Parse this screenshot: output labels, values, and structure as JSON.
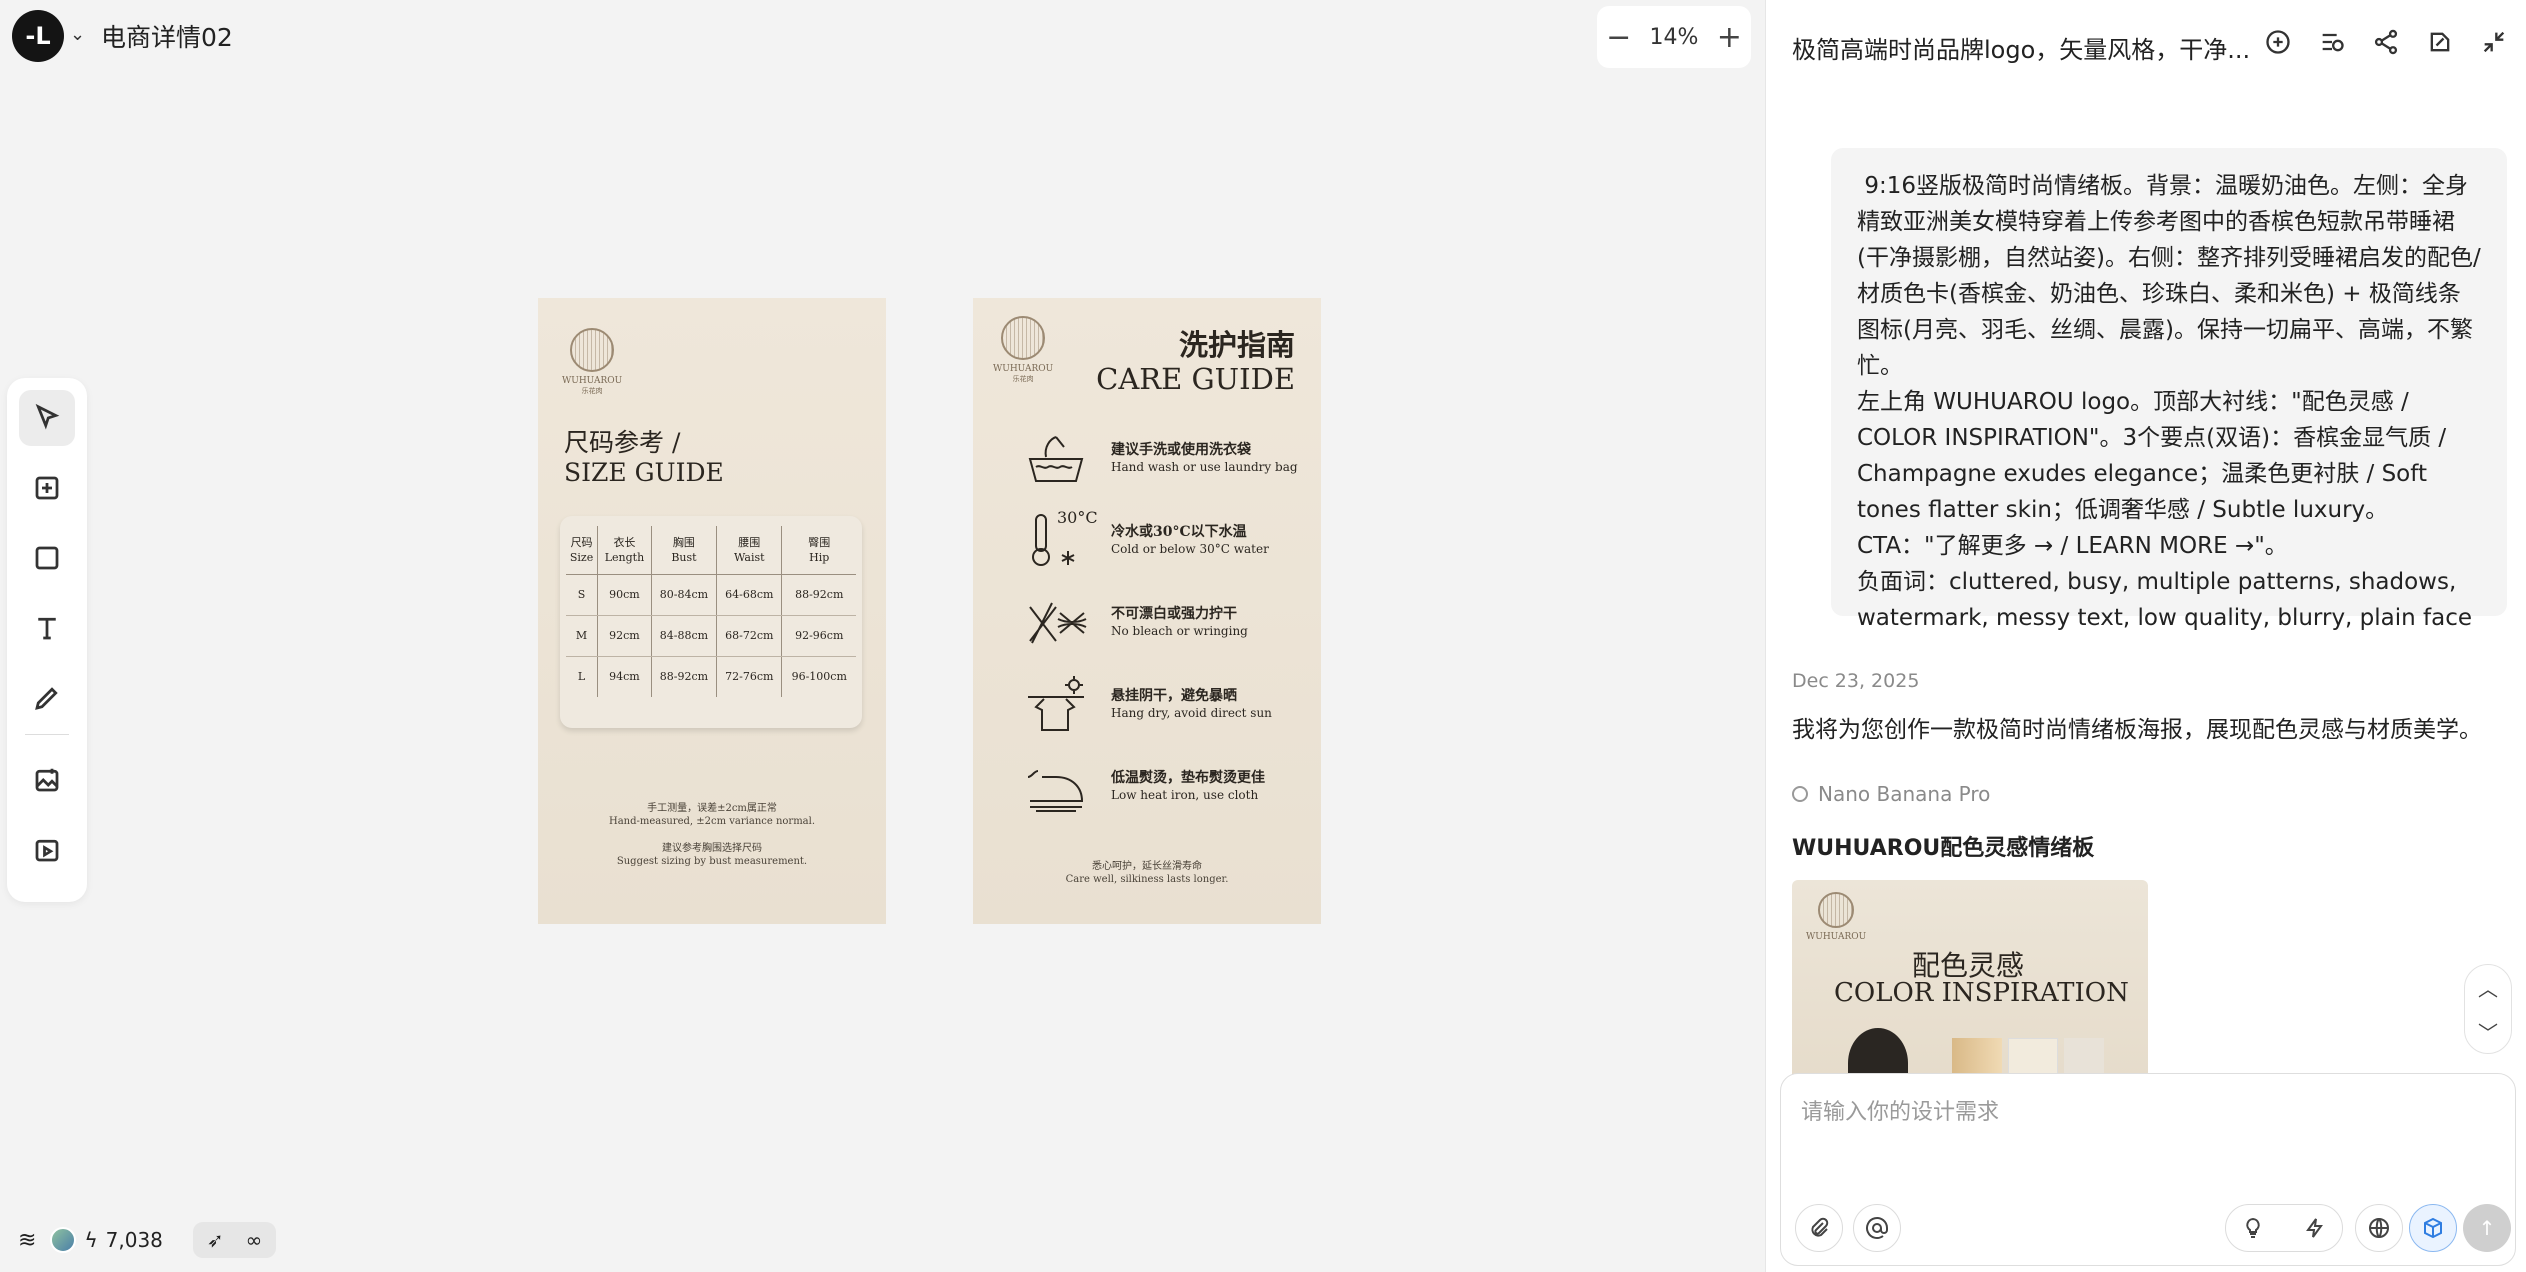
{
  "header": {
    "project_title": "电商详情02",
    "zoom": "14%"
  },
  "toolbar": {
    "tools": [
      "select",
      "add",
      "rectangle",
      "text",
      "pen",
      "image-gen",
      "video-gen"
    ]
  },
  "footer": {
    "credits": "7,038"
  },
  "card_size": {
    "brand": "WUHUAROU",
    "brand_sub": "乐花肉",
    "title_zh": "尺码参考 /",
    "title_en": "SIZE GUIDE",
    "headers": [
      [
        "尺码",
        "Size"
      ],
      [
        "衣长",
        "Length"
      ],
      [
        "胸围",
        "Bust"
      ],
      [
        "腰围",
        "Waist"
      ],
      [
        "臀围",
        "Hip"
      ]
    ],
    "rows": [
      [
        "S",
        "90cm",
        "80-84cm",
        "64-68cm",
        "88-92cm"
      ],
      [
        "M",
        "92cm",
        "84-88cm",
        "68-72cm",
        "92-96cm"
      ],
      [
        "L",
        "94cm",
        "88-92cm",
        "72-76cm",
        "96-100cm"
      ]
    ],
    "note1_zh": "手工测量，误差±2cm属正常",
    "note1_en": "Hand-measured, ±2cm variance normal.",
    "note2_zh": "建议参考胸围选择尺码",
    "note2_en": "Suggest sizing by bust measurement."
  },
  "card_care": {
    "title_zh": "洗护指南",
    "title_en": "CARE GUIDE",
    "items": [
      {
        "zh": "建议手洗或使用洗衣袋",
        "en": "Hand wash or use laundry bag",
        "icon": "hand-wash-icon"
      },
      {
        "zh": "冷水或30°C以下水温",
        "en": "Cold or below 30°C water",
        "icon": "thermometer-icon"
      },
      {
        "zh": "不可漂白或强力拧干",
        "en": "No bleach or wringing",
        "icon": "no-bleach-icon"
      },
      {
        "zh": "悬挂阴干，避免暴晒",
        "en": "Hang dry, avoid direct sun",
        "icon": "hang-dry-icon"
      },
      {
        "zh": "低温熨烫，垫布熨烫更佳",
        "en": "Low heat iron, use cloth",
        "icon": "iron-icon"
      }
    ],
    "temp_label": "30°C",
    "footer_zh": "悉心呵护，延长丝滑寿命",
    "footer_en": "Care well, silkiness lasts longer."
  },
  "panel": {
    "title": "极简高端时尚品牌logo，矢量风格，干净...",
    "prompt": " 9:16竖版极简时尚情绪板。背景：温暖奶油色。左侧：全身精致亚洲美女模特穿着上传参考图中的香槟色短款吊带睡裙(干净摄影棚，自然站姿)。右侧：整齐排列受睡裙启发的配色/材质色卡(香槟金、奶油色、珍珠白、柔和米色) + 极简线条图标(月亮、羽毛、丝绸、晨露)。保持一切扁平、高端，不繁忙。\n左上角 WUHUAROU logo。顶部大衬线：\"配色灵感 / COLOR INSPIRATION\"。3个要点(双语)：香槟金显气质 / Champagne exudes elegance；温柔色更衬肤 / Soft tones flatter skin；低调奢华感 / Subtle luxury。CTA：\"了解更多 → / LEARN MORE →\"。\n负面词：cluttered, busy, multiple patterns, shadows, watermark, messy text, low quality, blurry, plain face",
    "date": "Dec 23, 2025",
    "reply": "我将为您创作一款极简时尚情绪板海报，展现配色灵感与材质美学。",
    "model": "Nano Banana Pro",
    "result_title": "WUHUAROU配色灵感情绪板",
    "thumb_zh": "配色灵感",
    "thumb_en": "COLOR INSPIRATION",
    "input_placeholder": "请输入你的设计需求"
  }
}
